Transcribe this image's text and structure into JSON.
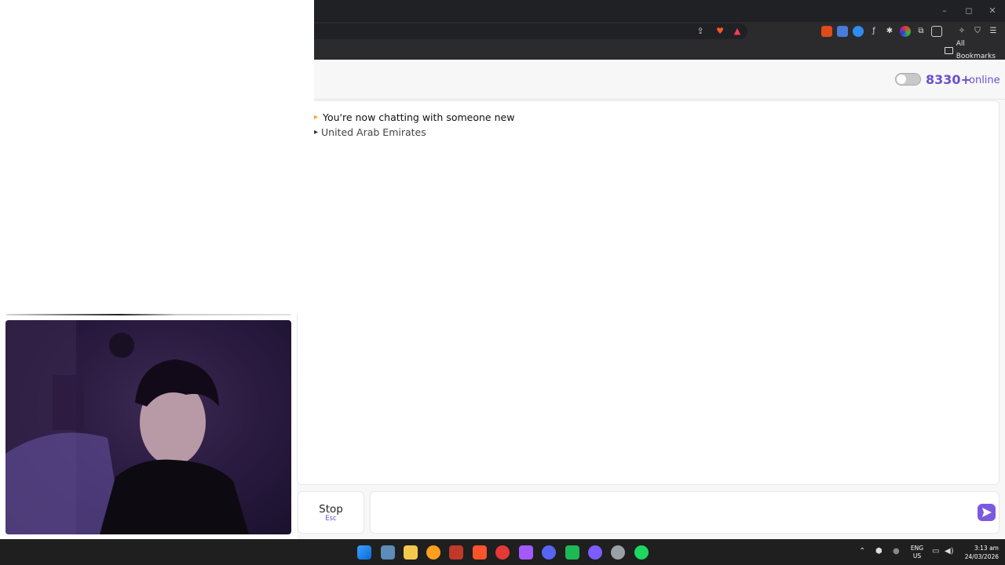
{
  "browser": {
    "bookmarks_label": "All Bookmarks",
    "window_controls": [
      "–",
      "◻",
      "✕"
    ]
  },
  "page": {
    "online_count": "8330+",
    "online_label": "online",
    "chat_messages": [
      "You're now chatting with someone new",
      "United Arab Emirates"
    ],
    "stop_label": "Stop",
    "stop_shortcut": "Esc",
    "message_placeholder": ""
  },
  "taskbar": {
    "language": "ENG",
    "region": "US",
    "time": "3:13 am",
    "date": "24/03/2026"
  },
  "colors": {
    "accent": "#6b4fd1",
    "send_button": "#7a5ae0"
  }
}
